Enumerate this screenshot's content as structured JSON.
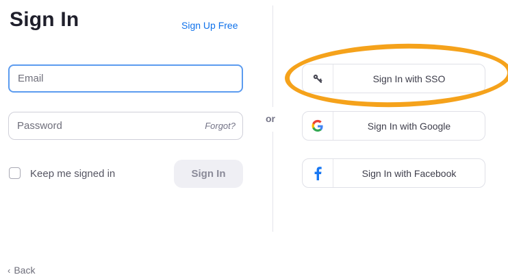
{
  "header": {
    "title": "Sign In",
    "signup_link": "Sign Up Free"
  },
  "form": {
    "email_placeholder": "Email",
    "password_placeholder": "Password",
    "forgot_link": "Forgot?",
    "keep_signed_in_label": "Keep me signed in",
    "keep_signed_in_checked": false,
    "signin_button": "Sign In"
  },
  "divider": {
    "or_text": "or"
  },
  "alt_signin": [
    {
      "label": "Sign In with SSO",
      "icon": "key-icon"
    },
    {
      "label": "Sign In with Google",
      "icon": "google-icon"
    },
    {
      "label": "Sign In with Facebook",
      "icon": "facebook-icon"
    }
  ],
  "annotation": {
    "highlight_color": "#f5a21b",
    "highlighted_item": "Sign In with SSO"
  },
  "footer": {
    "back_link": "Back"
  },
  "colors": {
    "link": "#0e71eb",
    "field_focus_border": "#5b9bef",
    "facebook_blue": "#1877f2"
  }
}
